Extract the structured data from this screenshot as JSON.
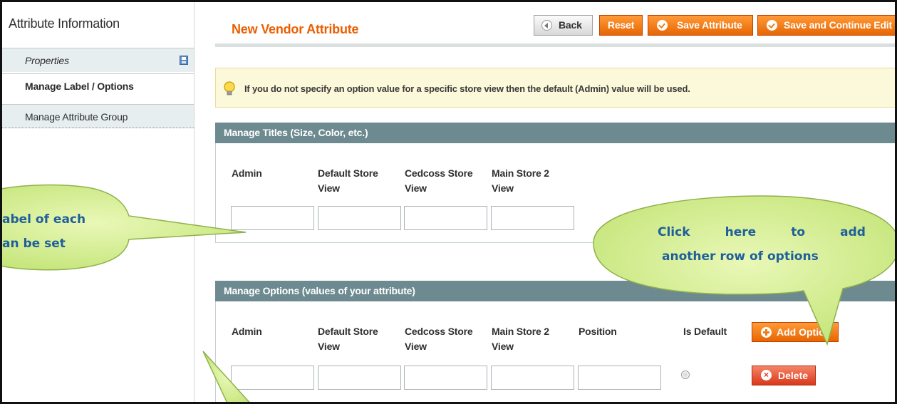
{
  "sidebar": {
    "title": "Attribute Information",
    "items": [
      {
        "label": "Properties"
      },
      {
        "label": "Manage Label / Options"
      },
      {
        "label": "Manage Attribute Group"
      }
    ]
  },
  "header": {
    "title": "New Vendor Attribute",
    "buttons": {
      "back": "Back",
      "reset": "Reset",
      "save": "Save Attribute",
      "save_continue": "Save and Continue Edit"
    }
  },
  "notice": {
    "text": "If you do not specify an option value for a specific store view then the default (Admin) value will be used."
  },
  "titles_section": {
    "heading": "Manage Titles (Size, Color, etc.)",
    "columns": [
      {
        "line1": "Admin",
        "line2": ""
      },
      {
        "line1": "Default Store",
        "line2": "View"
      },
      {
        "line1": "Cedcoss Store",
        "line2": "View"
      },
      {
        "line1": "Main Store 2",
        "line2": "View"
      }
    ],
    "values": [
      "",
      "",
      "",
      ""
    ]
  },
  "options_section": {
    "heading": "Manage Options (values of your attribute)",
    "columns": [
      {
        "line1": "Admin",
        "line2": ""
      },
      {
        "line1": "Default Store",
        "line2": "View"
      },
      {
        "line1": "Cedcoss Store",
        "line2": "View"
      },
      {
        "line1": "Main Store 2",
        "line2": "View"
      },
      {
        "line1": "Position",
        "line2": ""
      },
      {
        "line1": "Is Default",
        "line2": ""
      }
    ],
    "add_button": "Add Option",
    "delete_button": "Delete",
    "row_values": [
      "",
      "",
      "",
      "",
      ""
    ]
  },
  "callouts": {
    "left_line1": "abel of each",
    "left_line2": "an be set",
    "right_line1_words": [
      "Click",
      "here",
      "to",
      "add"
    ],
    "right_line2": "another row of options"
  },
  "colors": {
    "accent_orange": "#eb5e00",
    "section_header": "#6d8a90",
    "callout_fill": "#d3ef8a",
    "callout_text": "#1f5f9a"
  },
  "icons": [
    "disk-icon",
    "back-arrow-icon",
    "check-icon",
    "bulb-icon",
    "plus-icon",
    "x-icon"
  ]
}
